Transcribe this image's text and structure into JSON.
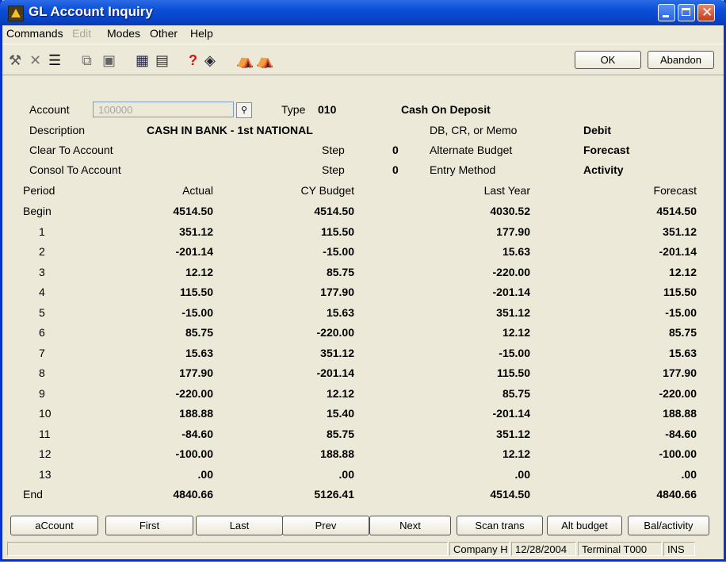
{
  "window": {
    "title": "GL Account Inquiry"
  },
  "menu": [
    "Commands",
    "Edit",
    "Modes",
    "Other",
    "Help"
  ],
  "buttons": {
    "ok": "OK",
    "abandon": "Abandon"
  },
  "header": {
    "account_label": "Account",
    "account_value": "100000",
    "type_label": "Type",
    "type_value": "010",
    "type_desc": "Cash On Deposit",
    "description_label": "Description",
    "description_value": "CASH IN BANK - 1st NATIONAL",
    "dbcr_label": "DB, CR, or Memo",
    "dbcr_value": "Debit",
    "clear_label": "Clear To Account",
    "step_label": "Step",
    "clear_step": "0",
    "alt_budget_label": "Alternate Budget",
    "alt_budget_value": "Forecast",
    "consol_label": "Consol To Account",
    "consol_step": "0",
    "entry_label": "Entry Method",
    "entry_value": "Activity"
  },
  "table": {
    "columns": [
      "Period",
      "Actual",
      "CY Budget",
      "Last Year",
      "Forecast"
    ],
    "rows": [
      [
        "Begin",
        "4514.50",
        "4514.50",
        "4030.52",
        "4514.50"
      ],
      [
        "1",
        "351.12",
        "115.50",
        "177.90",
        "351.12"
      ],
      [
        "2",
        "-201.14",
        "-15.00",
        "15.63",
        "-201.14"
      ],
      [
        "3",
        "12.12",
        "85.75",
        "-220.00",
        "12.12"
      ],
      [
        "4",
        "115.50",
        "177.90",
        "-201.14",
        "115.50"
      ],
      [
        "5",
        "-15.00",
        "15.63",
        "351.12",
        "-15.00"
      ],
      [
        "6",
        "85.75",
        "-220.00",
        "12.12",
        "85.75"
      ],
      [
        "7",
        "15.63",
        "351.12",
        "-15.00",
        "15.63"
      ],
      [
        "8",
        "177.90",
        "-201.14",
        "115.50",
        "177.90"
      ],
      [
        "9",
        "-220.00",
        "12.12",
        "85.75",
        "-220.00"
      ],
      [
        "10",
        "188.88",
        "15.40",
        "-201.14",
        "188.88"
      ],
      [
        "11",
        "-84.60",
        "85.75",
        "351.12",
        "-84.60"
      ],
      [
        "12",
        "-100.00",
        "188.88",
        "12.12",
        "-100.00"
      ],
      [
        "13",
        ".00",
        ".00",
        ".00",
        ".00"
      ],
      [
        "End",
        "4840.66",
        "5126.41",
        "4514.50",
        "4840.66"
      ]
    ]
  },
  "nav": [
    "aCcount",
    "First",
    "Last",
    "Prev",
    "Next",
    "Scan trans",
    "Alt budget",
    "Bal/activity"
  ],
  "status": {
    "company": "Company H",
    "date": "12/28/2004",
    "terminal": "Terminal T000",
    "mode": "INS"
  }
}
